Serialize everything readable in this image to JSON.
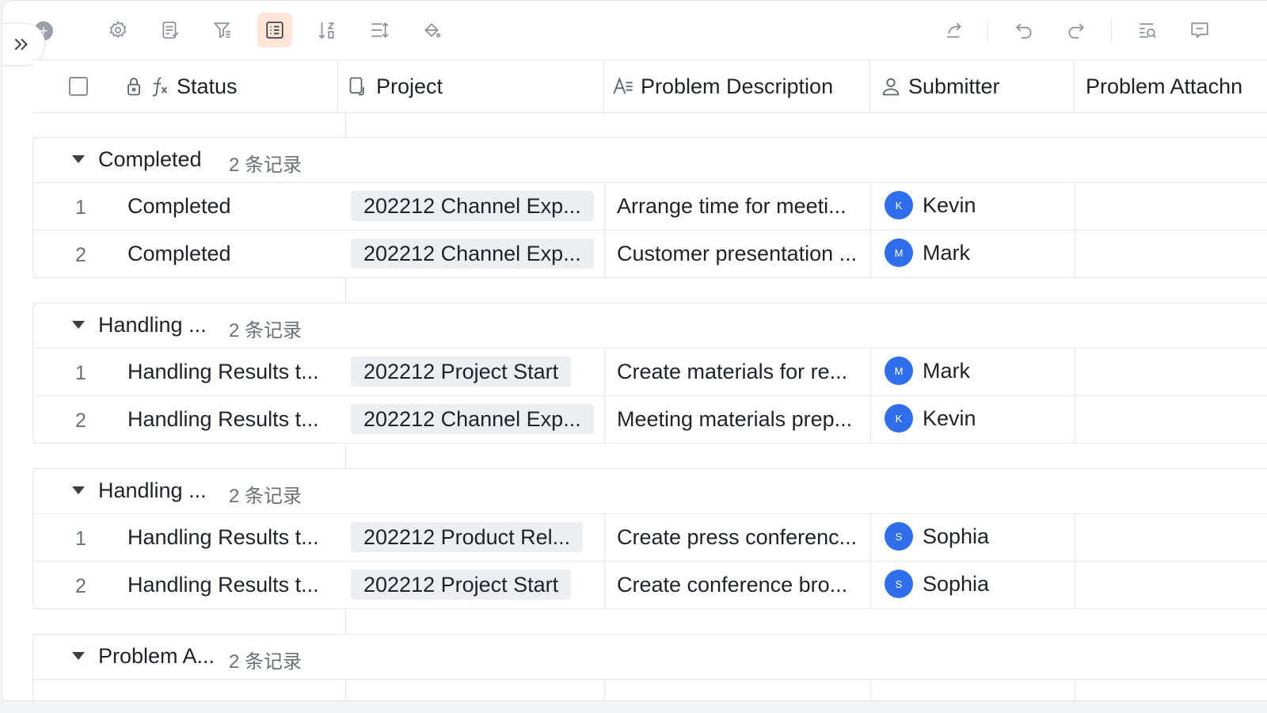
{
  "toolbar": {
    "left_icons": [
      "plus-icon",
      "settings-icon",
      "form-icon",
      "filter-icon",
      "list-view-icon",
      "sort-icon",
      "row-height-icon",
      "fill-color-icon"
    ],
    "right_icons": [
      "share-icon",
      "undo-icon",
      "redo-icon",
      "search-icon",
      "comment-icon"
    ],
    "active": "list-view-icon"
  },
  "header": {
    "status": "Status",
    "project": "Project",
    "problem_description": "Problem Description",
    "submitter": "Submitter",
    "problem_attachment": "Problem Attachn"
  },
  "groups": [
    {
      "title": "Completed",
      "count": "2 条记录",
      "rows": [
        {
          "num": "1",
          "status": "Completed",
          "project": "202212 Channel Exp...",
          "description": "Arrange time for meeti...",
          "avatar": "K",
          "submitter": "Kevin"
        },
        {
          "num": "2",
          "status": "Completed",
          "project": "202212 Channel Exp...",
          "description": "Customer presentation ...",
          "avatar": "M",
          "submitter": "Mark"
        }
      ]
    },
    {
      "title": "Handling ...",
      "count": "2 条记录",
      "rows": [
        {
          "num": "1",
          "status": "Handling Results t...",
          "project": "202212 Project Start",
          "description": "Create materials for re...",
          "avatar": "M",
          "submitter": "Mark"
        },
        {
          "num": "2",
          "status": "Handling Results t...",
          "project": "202212 Channel Exp...",
          "description": "Meeting materials prep...",
          "avatar": "K",
          "submitter": "Kevin"
        }
      ]
    },
    {
      "title": "Handling ...",
      "count": "2 条记录",
      "rows": [
        {
          "num": "1",
          "status": "Handling Results t...",
          "project": "202212 Product Rel...",
          "description": "Create press conferenc...",
          "avatar": "S",
          "submitter": "Sophia"
        },
        {
          "num": "2",
          "status": "Handling Results t...",
          "project": "202212 Project Start",
          "description": "Create conference bro...",
          "avatar": "S",
          "submitter": "Sophia"
        }
      ]
    },
    {
      "title": "Problem A...",
      "count": "2 条记录",
      "rows": []
    }
  ],
  "colors": {
    "accent_active_bg": "#fde6d6",
    "avatar_blue": "#2f6fed",
    "chip_bg": "#eceef1"
  }
}
